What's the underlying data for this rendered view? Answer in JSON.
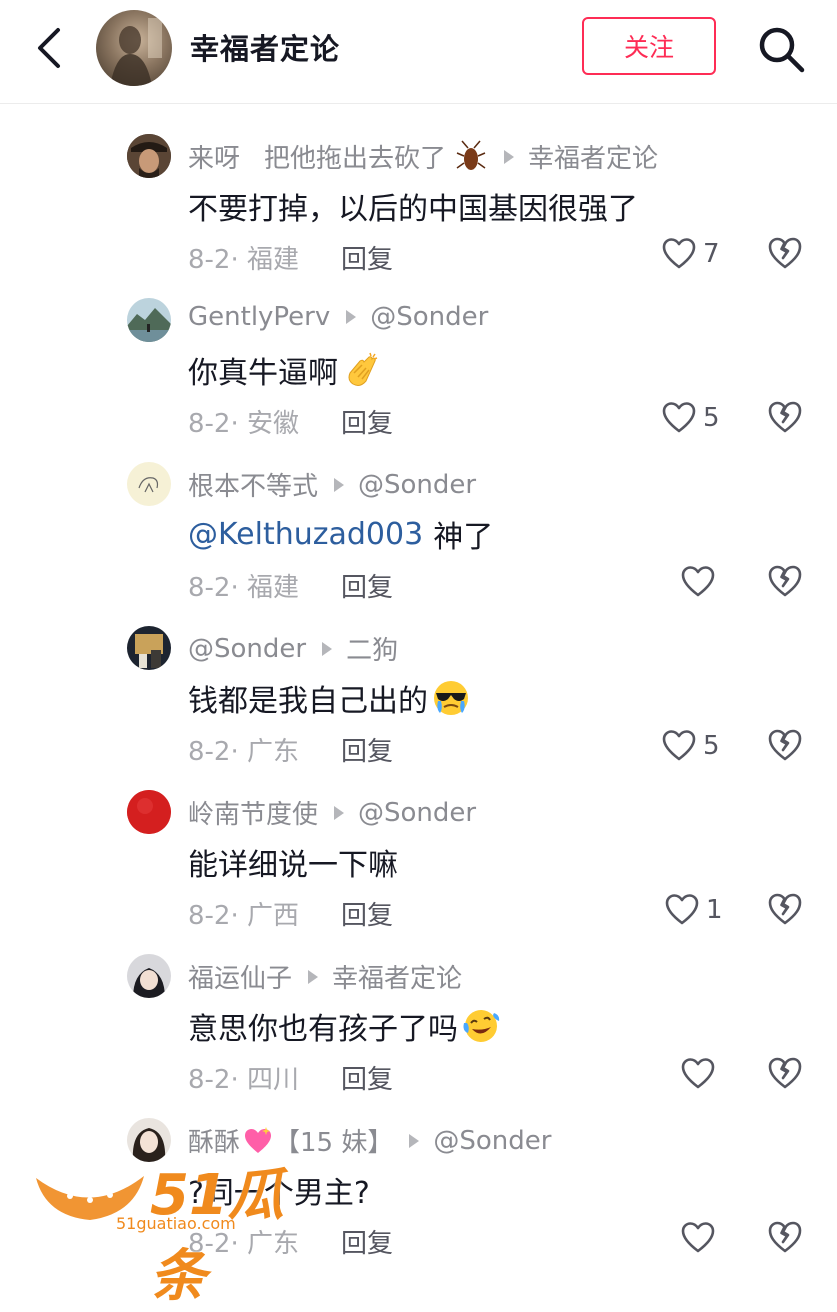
{
  "header": {
    "title": "幸福者定论",
    "follow_label": "关注"
  },
  "comments": [
    {
      "author": "来呀",
      "extra": "把他拖出去砍了",
      "reply_to": "幸福者定论",
      "text": "不要打掉，以后的中国基因很强了",
      "mention": "",
      "date": "8-2· 福建",
      "reply_label": "回复",
      "likes": "7",
      "emoji": "",
      "avatar_icon": "pirate-avatar"
    },
    {
      "author": "GentlyPerv",
      "extra": "",
      "reply_to": "@Sonder",
      "text": "你真牛逼啊",
      "mention": "",
      "date": "8-2· 安徽",
      "reply_label": "回复",
      "likes": "5",
      "emoji": "clapping-hands-emoji",
      "avatar_icon": "landscape-avatar"
    },
    {
      "author": "根本不等式",
      "extra": "",
      "reply_to": "@Sonder",
      "text": "神了",
      "mention": "@Kelthuzad003",
      "date": "8-2· 福建",
      "reply_label": "回复",
      "likes": "",
      "emoji": "",
      "avatar_icon": "sketch-avatar"
    },
    {
      "author": "@Sonder",
      "extra": "",
      "reply_to": "二狗",
      "text": "钱都是我自己出的",
      "mention": "",
      "date": "8-2· 广东",
      "reply_label": "回复",
      "likes": "5",
      "emoji": "sunglasses-tears-emoji",
      "avatar_icon": "room-avatar"
    },
    {
      "author": "岭南节度使",
      "extra": "",
      "reply_to": "@Sonder",
      "text": "能详细说一下嘛",
      "mention": "",
      "date": "8-2· 广西",
      "reply_label": "回复",
      "likes": "1",
      "emoji": "",
      "avatar_icon": "red-circle-avatar"
    },
    {
      "author": "福运仙子",
      "extra": "",
      "reply_to": "幸福者定论",
      "text": "意思你也有孩子了吗",
      "mention": "",
      "date": "8-2· 四川",
      "reply_label": "回复",
      "likes": "",
      "emoji": "laughing-tears-emoji",
      "avatar_icon": "girl-avatar"
    },
    {
      "author": "酥酥",
      "extra": "【15 妹】",
      "reply_to": "@Sonder",
      "text": "?同一个男主?",
      "mention": "",
      "date": "8-2· 广东",
      "reply_label": "回复",
      "likes": "",
      "emoji": "",
      "avatar_icon": "woman-avatar"
    }
  ],
  "watermark": {
    "brand": "51瓜条",
    "url": "51guatiao.com"
  },
  "colors": {
    "accent": "#fe2c55",
    "mention": "#2d5e9e",
    "muted": "#8a8b91"
  }
}
